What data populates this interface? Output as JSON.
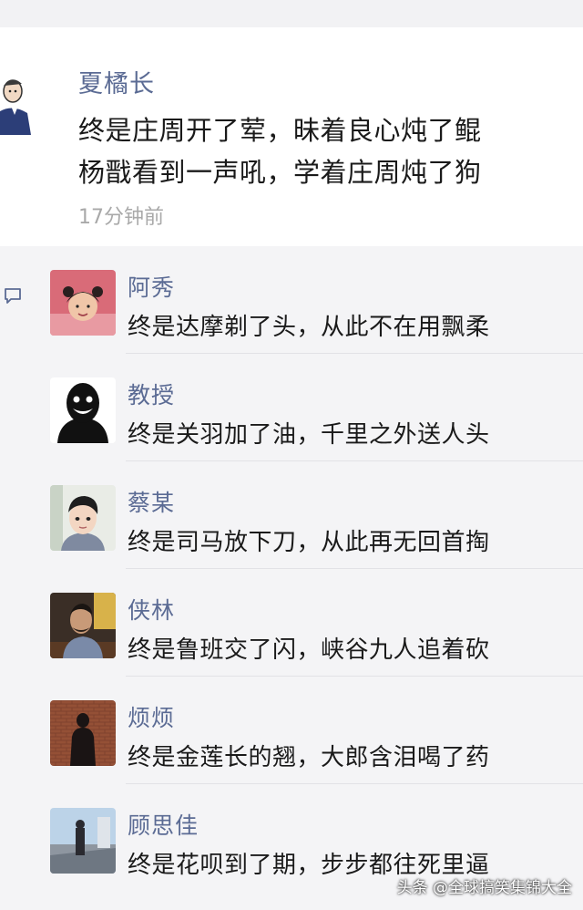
{
  "post": {
    "author": "夏橘长",
    "lines": [
      "终是庄周开了荤，昧着良心炖了鲲",
      "杨戬看到一声吼，学着庄周炖了狗"
    ],
    "time": "17分钟前",
    "avatar_icon": "cartoon-person-icon"
  },
  "comments": [
    {
      "name": "阿秀",
      "text": "终是达摩剃了头，从此不在用飘柔",
      "avatar_icon": "girl-photo-avatar"
    },
    {
      "name": "教授",
      "text": "终是关羽加了油，千里之外送人头",
      "avatar_icon": "shadow-smile-avatar"
    },
    {
      "name": "蔡某",
      "text": "终是司马放下刀，从此再无回首掏",
      "avatar_icon": "cartoon-boy-avatar"
    },
    {
      "name": "侠林",
      "text": "终是鲁班交了闪，峡谷九人追着砍",
      "avatar_icon": "man-photo-avatar"
    },
    {
      "name": "烦烦",
      "text": "终是金莲长的翘，大郎含泪喝了药",
      "avatar_icon": "silhouette-photo-avatar"
    },
    {
      "name": "顾思佳",
      "text": "终是花呗到了期，步步都往死里逼",
      "avatar_icon": "street-photo-avatar"
    }
  ],
  "watermark": "头条 @全球搞笑集锦大全",
  "colors": {
    "name_blue": "#5b6b94",
    "text": "#1a1a1a",
    "time_gray": "#a9a9a9",
    "comment_bg": "#f4f4f6"
  }
}
